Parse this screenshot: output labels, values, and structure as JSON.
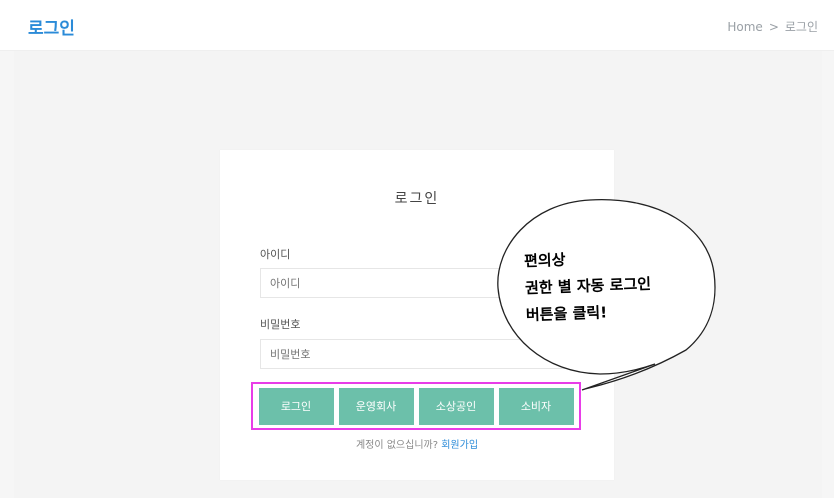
{
  "header": {
    "title": "로그인",
    "breadcrumb": [
      "Home",
      "로그인"
    ],
    "breadcrumb_separator": ">"
  },
  "login": {
    "title": "로그인",
    "id_label": "아이디",
    "id_placeholder": "아이디",
    "pw_label": "비밀번호",
    "pw_placeholder": "비밀번호",
    "buttons": [
      "로그인",
      "운영회사",
      "소상공인",
      "소비자"
    ],
    "signup_text": "계정이 없으십니까?",
    "signup_link": "회원가입"
  },
  "annotation": {
    "lines": [
      "편의상",
      "권한 별 자동 로그인",
      "버튼을 클릭!"
    ]
  },
  "colors": {
    "accent": "#2b8bd8",
    "button": "#6cc0aa",
    "highlight": "#e83de8"
  }
}
